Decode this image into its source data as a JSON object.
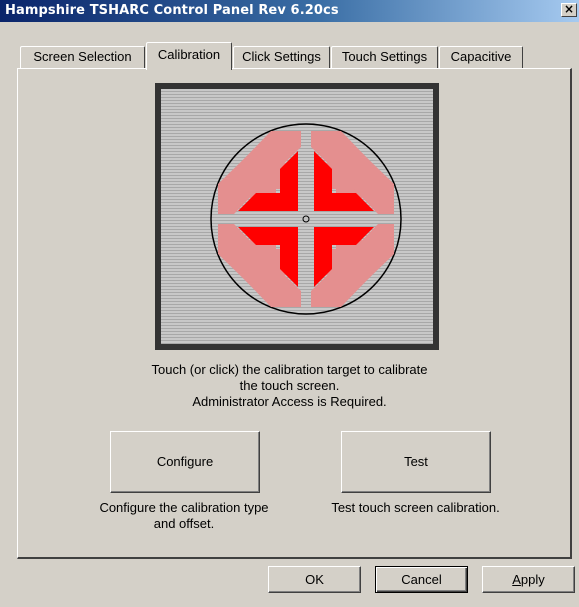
{
  "window": {
    "title": "Hampshire TSHARC Control Panel Rev 6.20cs",
    "close_label": "×"
  },
  "tabs": [
    {
      "label": "Screen Selection",
      "active": false
    },
    {
      "label": "Calibration",
      "active": true
    },
    {
      "label": "Click Settings",
      "active": false
    },
    {
      "label": "Touch Settings",
      "active": false
    },
    {
      "label": "Capacitive",
      "active": false
    }
  ],
  "calibration": {
    "target_icon": "calibration-target-icon",
    "instruction_lines": [
      "Touch (or click) the calibration target to calibrate",
      "the touch screen.",
      "Administrator Access is Required."
    ],
    "configure_button": "Configure",
    "configure_caption_lines": [
      "Configure the calibration type",
      "and offset."
    ],
    "test_button": "Test",
    "test_caption": "Test touch screen calibration."
  },
  "footer": {
    "ok": "OK",
    "cancel": "Cancel",
    "apply": "Apply",
    "apply_accelerator": "A",
    "apply_rest": "pply"
  },
  "colors": {
    "title_active": "#0a246a",
    "face": "#d4d0c8",
    "arrow_red": "#ff0000",
    "arrow_pink": "#e48f8f"
  }
}
